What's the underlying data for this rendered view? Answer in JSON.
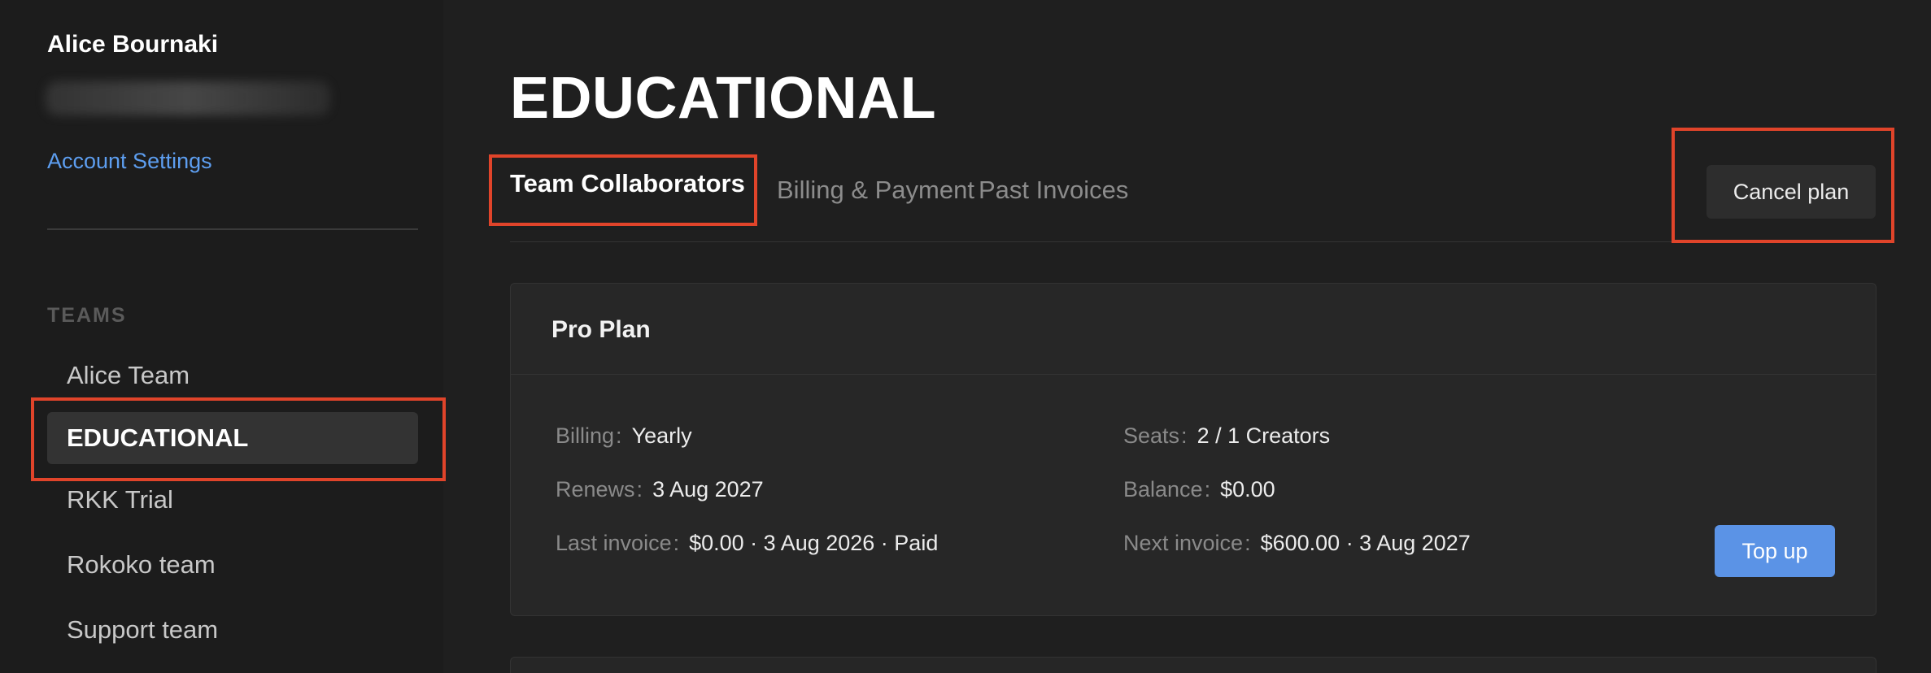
{
  "sidebar": {
    "user_name": "Alice Bournaki",
    "account_settings_label": "Account Settings",
    "teams_heading": "TEAMS",
    "teams": [
      {
        "label": "Alice Team"
      },
      {
        "label": "EDUCATIONAL"
      },
      {
        "label": "RKK Trial"
      },
      {
        "label": "Rokoko team"
      },
      {
        "label": "Support team"
      }
    ],
    "active_team": "EDUCATIONAL"
  },
  "main": {
    "page_title": "EDUCATIONAL",
    "tabs": [
      {
        "label": "Team Collaborators"
      },
      {
        "label": "Billing & Payment"
      },
      {
        "label": "Past Invoices"
      }
    ],
    "active_tab": "Team Collaborators",
    "cancel_plan_label": "Cancel plan",
    "plan": {
      "title": "Pro Plan",
      "billing_label": "Billing",
      "billing_value": "Yearly",
      "renews_label": "Renews",
      "renews_value": "3 Aug 2027",
      "last_invoice_label": "Last invoice",
      "last_invoice_value": "$0.00 · 3 Aug 2026 · Paid",
      "seats_label": "Seats",
      "seats_value": "2 / 1 Creators",
      "balance_label": "Balance",
      "balance_value": "$0.00",
      "next_invoice_label": "Next invoice",
      "next_invoice_value": "$600.00 · 3 Aug 2027",
      "separator": ":",
      "top_up_label": "Top up"
    }
  },
  "colors": {
    "accent_link": "#5d9ef0",
    "primary_button": "#5b93e6",
    "highlight_outline": "#e0442a",
    "background": "#1f1f1f"
  }
}
